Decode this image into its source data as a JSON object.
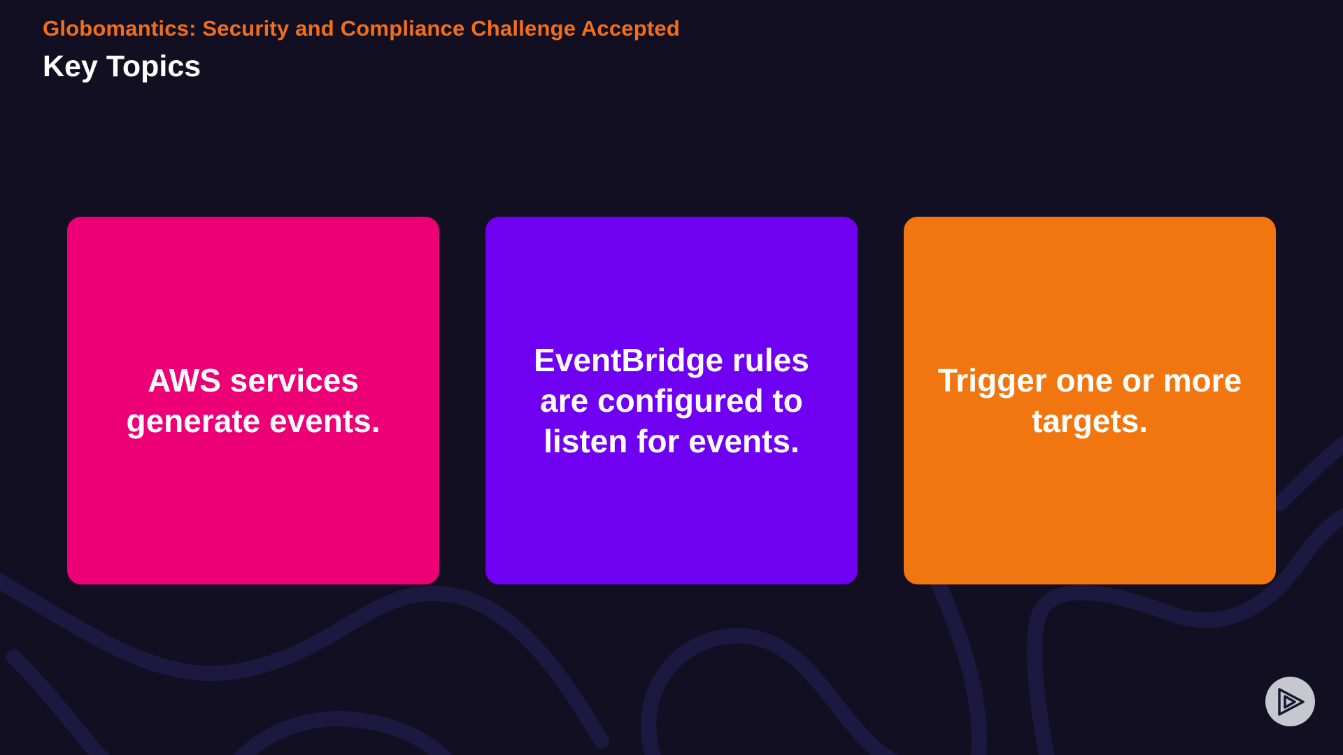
{
  "header": {
    "subtitle": "Globomantics: Security and Compliance Challenge Accepted",
    "title": "Key Topics"
  },
  "cards": [
    {
      "text": "AWS services generate events.",
      "color": "#ed0076"
    },
    {
      "text": "EventBridge rules are configured to listen for events.",
      "color": "#7000f2"
    },
    {
      "text": "Trigger one or more targets.",
      "color": "#f2760f"
    }
  ],
  "colors": {
    "background": "#120f22",
    "accent": "#f26f1a",
    "decor_lines": "#1d1a40"
  },
  "brand": {
    "icon": "pluralsight-play-icon"
  }
}
